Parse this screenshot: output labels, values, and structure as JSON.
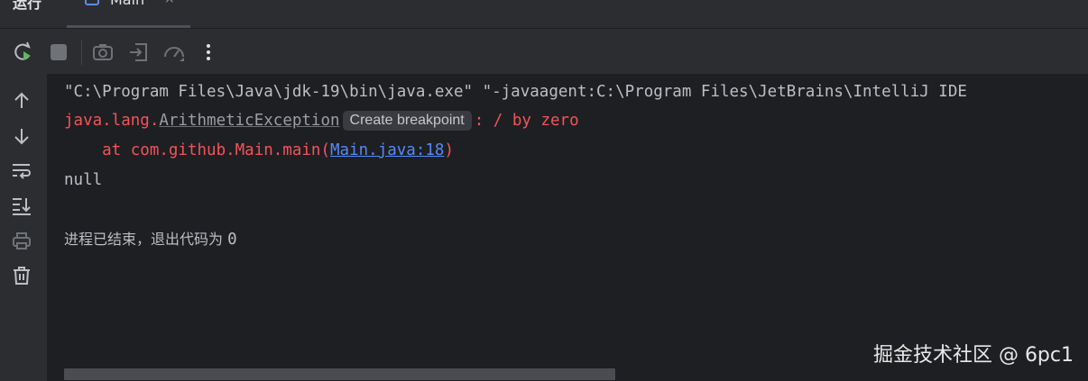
{
  "header": {
    "run_title": "运行",
    "tab_label": "Main",
    "tab_close": "×"
  },
  "toolbar": {
    "buttons": [
      "rerun-icon",
      "stop-icon",
      "screenshot-icon",
      "restore-layout-icon",
      "profiler-icon",
      "more-icon"
    ]
  },
  "sidebar": {
    "buttons": [
      "arrow-up-icon",
      "arrow-down-icon",
      "soft-wrap-icon",
      "scroll-to-end-icon",
      "print-icon",
      "trash-icon"
    ]
  },
  "console": {
    "command": "\"C:\\Program Files\\Java\\jdk-19\\bin\\java.exe\" \"-javaagent:C:\\Program Files\\JetBrains\\IntelliJ IDE",
    "exception_prefix": "java.lang.",
    "exception_name": "ArithmeticException",
    "tooltip": "Create breakpoint",
    "exception_message": ": / by zero",
    "stack_prefix": "    at com.github.Main.main(",
    "stack_link": "Main.java:18",
    "stack_suffix": ")",
    "output_null": "null",
    "exit_message": "进程已结束，退出代码为 ",
    "exit_code": "0"
  },
  "watermark": "掘金技术社区 @ 6pc1",
  "colors": {
    "background": "#1e1f22",
    "panel": "#2b2d30",
    "error": "#f2545b",
    "link": "#548af7",
    "rerun_green": "#5fb85f"
  }
}
